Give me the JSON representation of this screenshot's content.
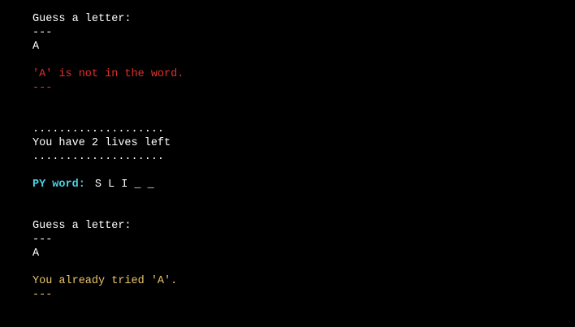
{
  "terminal": {
    "colors": {
      "background": "#000000",
      "text": "#ffffff",
      "error": "#e0302c",
      "warning": "#e9c46a",
      "highlight": "#4dd0e1"
    },
    "block1": {
      "prompt": "Guess a letter:",
      "separator_top": "---",
      "input": "A",
      "message": "'A' is not in the word.",
      "separator_bottom": "---"
    },
    "status": {
      "dots_top": "....................",
      "lives": "You have 2 lives left",
      "dots_bottom": "...................."
    },
    "word": {
      "label": "PY word:",
      "letters": "S L I _ _"
    },
    "block2": {
      "prompt": "Guess a letter:",
      "separator_top": "---",
      "input": "A",
      "message": "You already tried 'A'.",
      "separator_bottom": "---"
    }
  }
}
